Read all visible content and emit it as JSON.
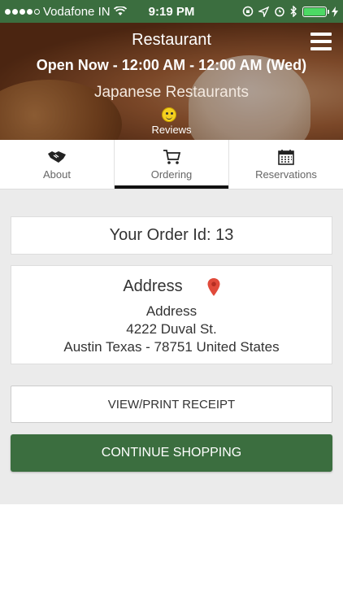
{
  "status_bar": {
    "carrier": "Vodafone IN",
    "time": "9:19 PM",
    "signal_bars_filled": 4,
    "signal_bars_total": 5,
    "battery_level": 1.0
  },
  "hero": {
    "title": "Restaurant",
    "hours": "Open Now - 12:00 AM - 12:00 AM (Wed)",
    "category": "Japanese Restaurants",
    "reviews_label": "Reviews"
  },
  "tabs": [
    {
      "label": "About",
      "icon": "handshake-icon",
      "active": false
    },
    {
      "label": "Ordering",
      "icon": "cart-icon",
      "active": true
    },
    {
      "label": "Reservations",
      "icon": "calendar-icon",
      "active": false
    }
  ],
  "order": {
    "id_text": "Your Order Id: 13"
  },
  "address": {
    "heading": "Address",
    "lines": [
      "Address",
      "4222 Duval St.",
      "Austin Texas - 78751 United States"
    ]
  },
  "buttons": {
    "receipt": "VIEW/PRINT RECEIPT",
    "continue": "CONTINUE SHOPPING"
  },
  "colors": {
    "brand_green": "#3b6e3f",
    "pin_red": "#e04a3a"
  }
}
